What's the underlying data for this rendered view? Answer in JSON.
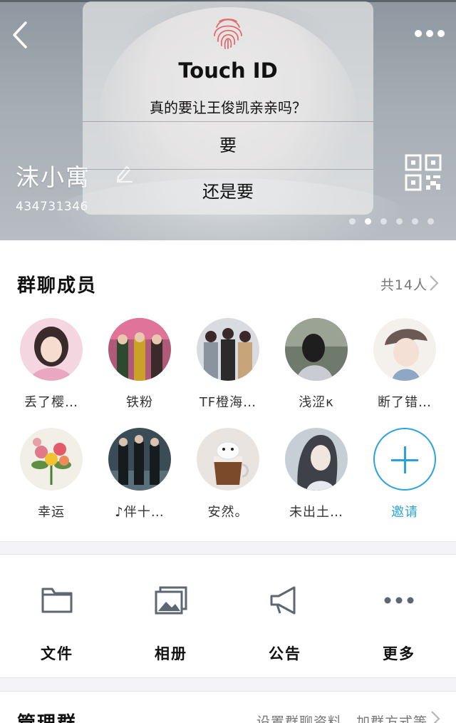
{
  "header": {
    "group_name": "沫小寓",
    "group_id": "434731346",
    "page_count": 6,
    "active_page": 2
  },
  "alert": {
    "title": "Touch ID",
    "message": "真的要让王俊凯亲亲吗？",
    "button_1": "要",
    "button_2": "还是要"
  },
  "members_section": {
    "title": "群聊成员",
    "count_label": "共14人",
    "members": [
      {
        "name": "丢了樱…"
      },
      {
        "name": "铁粉"
      },
      {
        "name": "TF橙海…"
      },
      {
        "name": "浅涩κ"
      },
      {
        "name": "断了错…"
      },
      {
        "name": "幸运"
      },
      {
        "name": "♪伴十…"
      },
      {
        "name": "安然。"
      },
      {
        "name": "未出土…"
      }
    ],
    "invite_label": "邀请"
  },
  "features": [
    {
      "label": "文件",
      "icon": "folder-icon"
    },
    {
      "label": "相册",
      "icon": "photo-album-icon"
    },
    {
      "label": "公告",
      "icon": "megaphone-icon"
    },
    {
      "label": "更多",
      "icon": "more-dots-icon"
    }
  ],
  "manage": {
    "title": "管理群",
    "subtitle": "设置群聊资料、加群方式等"
  },
  "colors": {
    "accent": "#2aa4d8",
    "text_primary": "#111111",
    "text_secondary": "#777777"
  }
}
